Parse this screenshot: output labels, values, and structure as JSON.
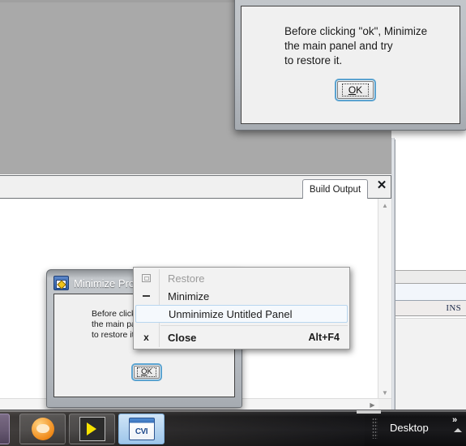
{
  "desktop": {
    "background_color": "#ffffff"
  },
  "main_panel": {
    "name": "Untitled Panel",
    "background_color": "#a9a9a9"
  },
  "build_output_window": {
    "tab_label": "Build Output",
    "close_icon": "close-icon",
    "scroll_up_icon": "▲",
    "scroll_down_icon": "▼",
    "scroll_right_icon": "▶",
    "content_text": ""
  },
  "ide_window": {
    "status_text": "INS"
  },
  "top_dialog": {
    "message": "Before clicking \"ok\", Minimize\nthe main panel and try\nto restore it.",
    "ok_button": {
      "accel_letter": "O",
      "rest_label": "K",
      "focused": true
    }
  },
  "small_dialog": {
    "title": "Minimize Pro",
    "icon": "panel-icon",
    "message": "Before click\nthe main pa\nto restore it",
    "ok_button": {
      "accel_letter": "O",
      "rest_label": "K",
      "focused": true
    }
  },
  "context_menu": {
    "items": [
      {
        "label": "Restore",
        "accel": "",
        "glyph": "restore-icon",
        "disabled": true,
        "highlighted": false,
        "bold": false
      },
      {
        "label": "Minimize",
        "accel": "",
        "glyph": "minimize-icon",
        "disabled": false,
        "highlighted": false,
        "bold": false
      },
      {
        "label": "Unminimize Untitled Panel",
        "accel": "",
        "glyph": "",
        "disabled": false,
        "highlighted": true,
        "bold": false
      },
      {
        "label": "Close",
        "accel": "Alt+F4",
        "glyph": "close-icon",
        "disabled": false,
        "highlighted": false,
        "bold": true
      }
    ]
  },
  "taskbar": {
    "buttons": [
      {
        "name": "taskbar-item-partial",
        "icon": "unknown-app-icon"
      },
      {
        "name": "taskbar-item-chat",
        "icon": "chat-bubble-icon"
      },
      {
        "name": "taskbar-item-labview",
        "icon": "labview-icon"
      },
      {
        "name": "taskbar-item-cvi",
        "icon": "cvi-icon",
        "icon_text": "CVI",
        "active": true
      }
    ],
    "tray": {
      "show_desktop_label": "Desktop",
      "overflow_icon": "»",
      "show_hidden_icon": "up-arrow-icon"
    }
  }
}
